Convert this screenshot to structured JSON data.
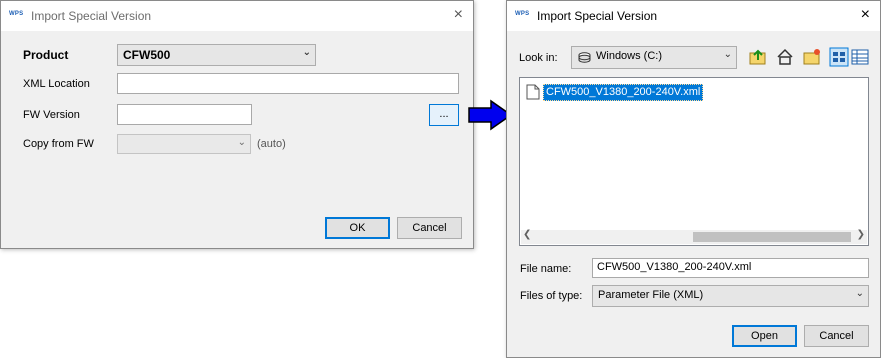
{
  "dialog1": {
    "logo": "WPS",
    "title": "Import Special Version",
    "close_glyph": "×",
    "product_label": "Product",
    "product_value": "CFW500",
    "xml_location_label": "XML Location",
    "xml_location_value": "",
    "fw_version_label": "FW Version",
    "fw_version_value": "",
    "browse_label": "...",
    "copy_from_fw_label": "Copy from FW",
    "copy_from_fw_value": "",
    "auto_text": "(auto)",
    "ok_label": "OK",
    "cancel_label": "Cancel"
  },
  "dialog2": {
    "logo": "WPS",
    "title": "Import Special Version",
    "close_glyph": "×",
    "look_in_label": "Look in:",
    "look_in_value": "Windows (C:)",
    "files": [
      "CFW500_V1380_200-240V.xml"
    ],
    "file_name_label": "File name:",
    "file_name_value": "CFW500_V1380_200-240V.xml",
    "files_of_type_label": "Files of type:",
    "files_of_type_value": "Parameter File (XML)",
    "open_label": "Open",
    "cancel_label": "Cancel"
  },
  "icons": [
    "up-folder-icon",
    "home-icon",
    "new-folder-icon",
    "list-view-icon",
    "details-view-icon",
    "drive-icon",
    "file-icon",
    "chevron-down-icon",
    "arrow-right-icon"
  ],
  "colors": {
    "selection": "#0078d7",
    "arrow_fill": "#0000ee",
    "default_button_border": "#0078d7"
  }
}
